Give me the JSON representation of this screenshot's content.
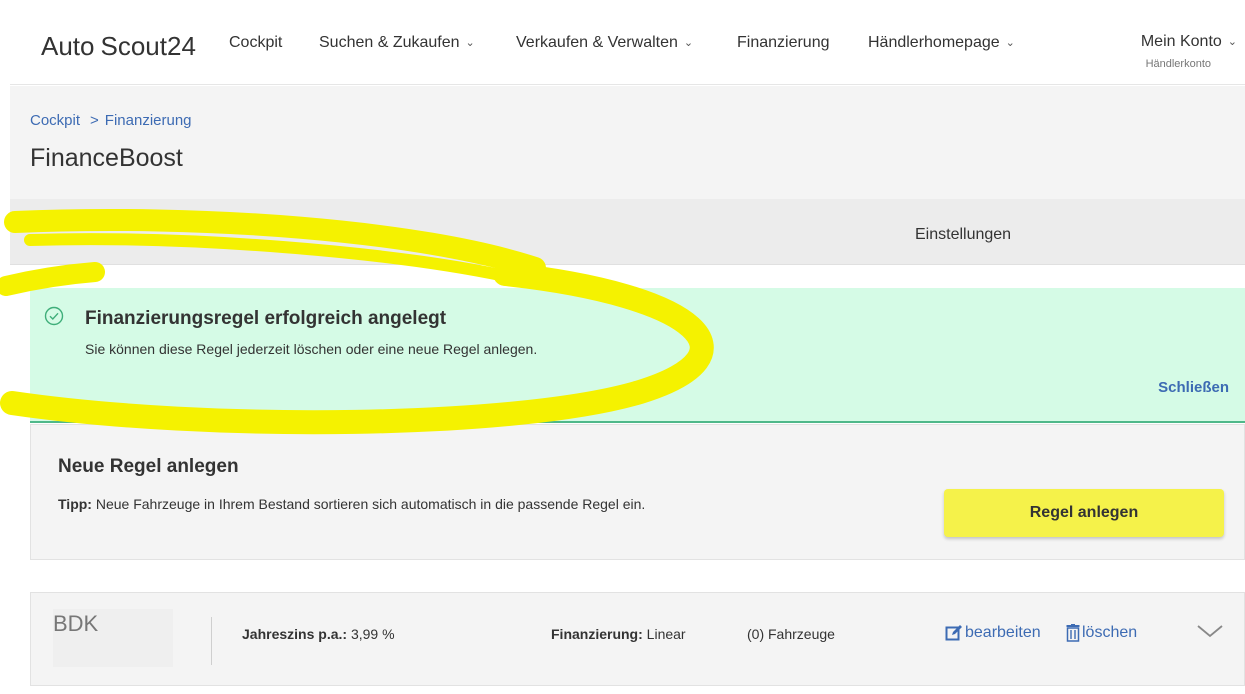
{
  "nav": {
    "logo_auto": "Auto",
    "logo_scout": "Scout24",
    "items": [
      {
        "label": "Cockpit",
        "chevron": false
      },
      {
        "label": "Suchen & Zukaufen",
        "chevron": true
      },
      {
        "label": "Verkaufen & Verwalten",
        "chevron": true
      },
      {
        "label": "Finanzierung",
        "chevron": false
      },
      {
        "label": "Händlerhomepage",
        "chevron": true
      }
    ],
    "account_label": "Mein Konto",
    "account_sub": "Händlerkonto"
  },
  "breadcrumb": {
    "root": "Cockpit",
    "current": "Finanzierung"
  },
  "page_title": "FinanceBoost",
  "tabs": {
    "settings": "Einstellungen"
  },
  "success": {
    "title": "Finanzierungsregel erfolgreich angelegt",
    "text": "Sie können diese Regel jederzeit löschen oder eine neue Regel anlegen.",
    "close": "Schließen"
  },
  "new_rule": {
    "title": "Neue Regel anlegen",
    "tip_label": "Tipp:",
    "tip_text": "Neue Fahrzeuge in Ihrem Bestand sortieren sich automatisch in die passende Regel ein.",
    "button": "Regel anlegen"
  },
  "rule": {
    "bank": "BDK",
    "rate_label": "Jahreszins p.a.:",
    "rate_value": "3,99 %",
    "financing_label": "Finanzierung:",
    "financing_value": "Linear",
    "vehicles": "(0) Fahrzeuge",
    "edit": "bearbeiten",
    "delete": "löschen"
  },
  "colors": {
    "brand_yellow": "#f5f200",
    "link_blue": "#3d6bb3",
    "success_bg": "#d5fbe6",
    "success_border": "#4fb88a",
    "button_yellow": "#f5f24a"
  },
  "icons": [
    "chevron-down-icon",
    "check-circle-icon",
    "edit-icon",
    "trash-icon",
    "expand-chevron-icon"
  ]
}
